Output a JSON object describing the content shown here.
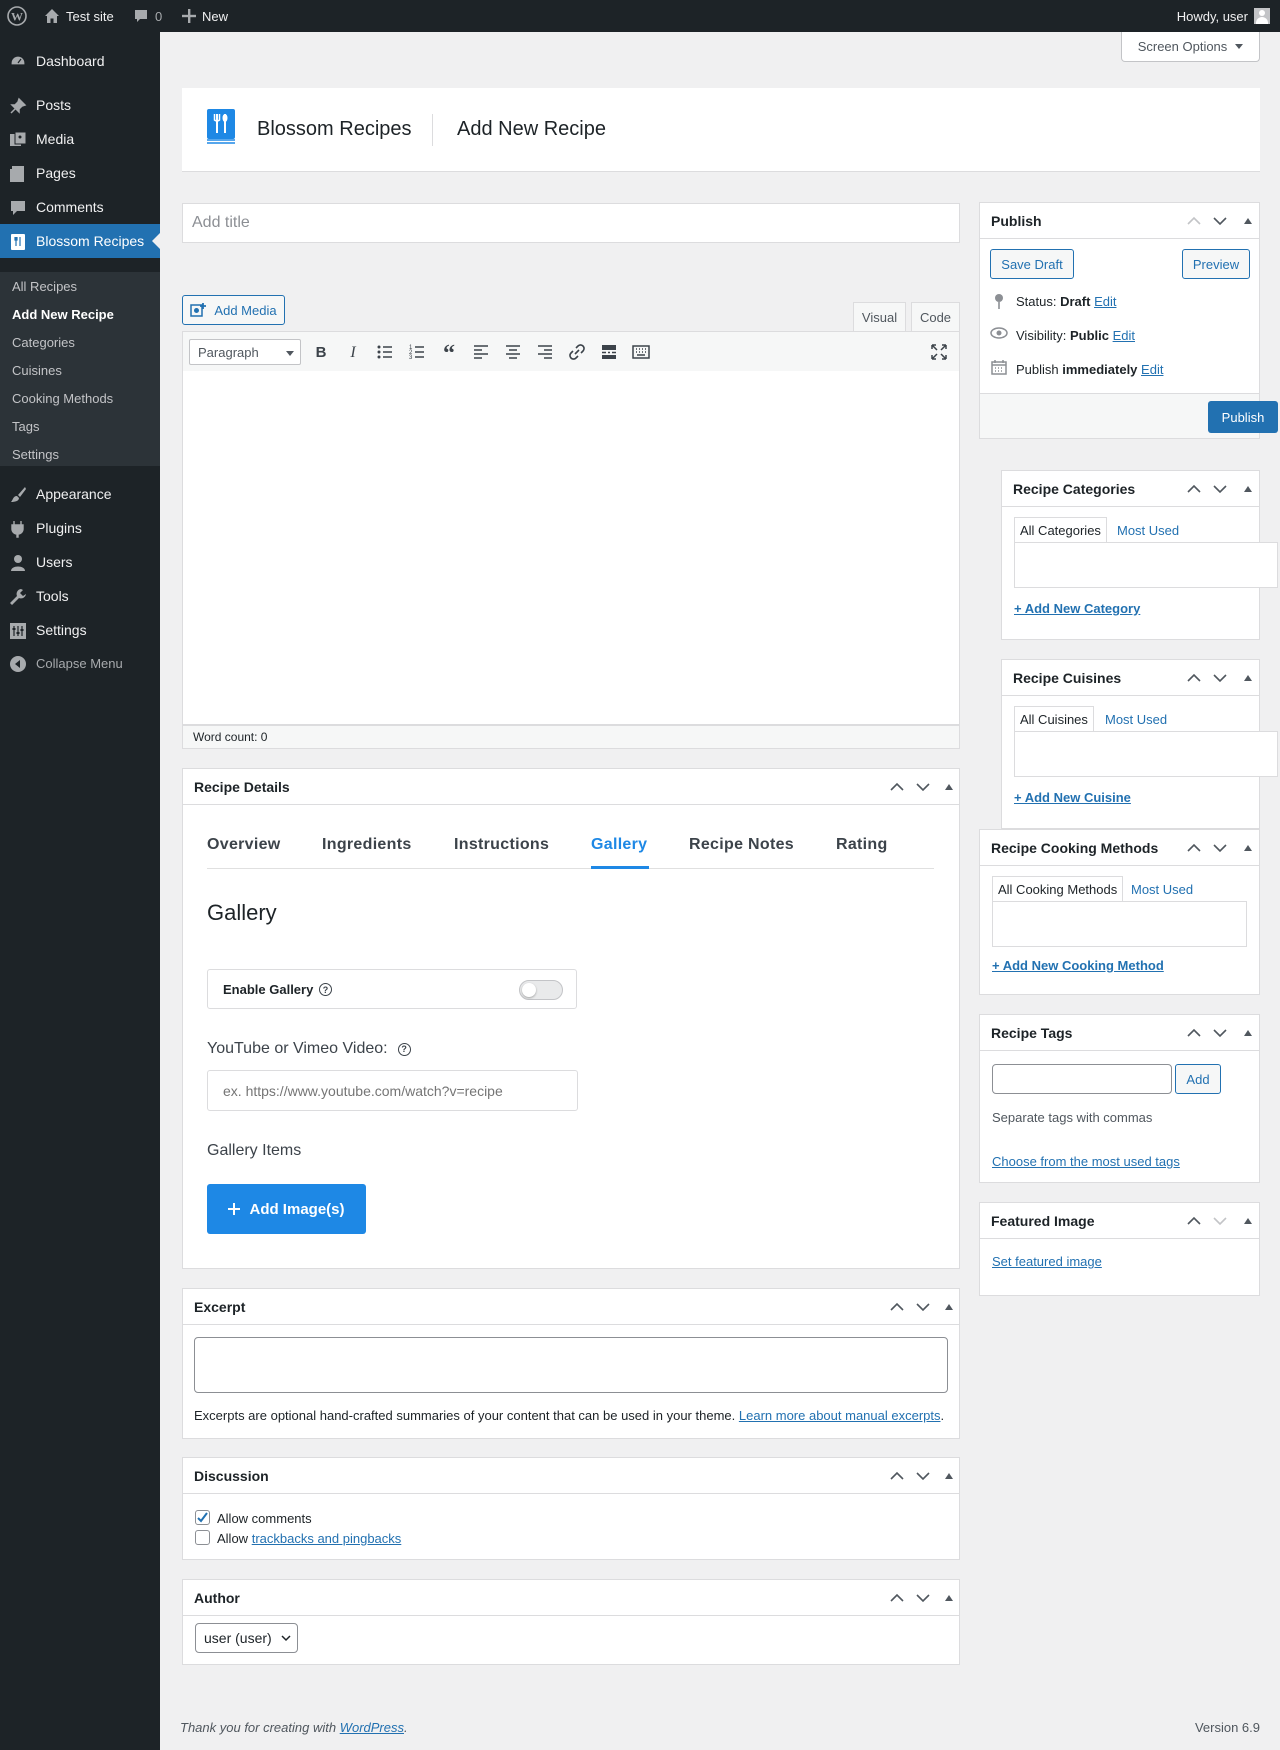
{
  "adminbar": {
    "site_name": "Test site",
    "comments_count": "0",
    "new_label": "New",
    "howdy": "Howdy, user"
  },
  "menu": {
    "items": [
      {
        "label": "Dashboard",
        "icon": "dashboard-icon"
      },
      {
        "label": "Posts",
        "icon": "pin-icon"
      },
      {
        "label": "Media",
        "icon": "media-icon"
      },
      {
        "label": "Pages",
        "icon": "pages-icon"
      },
      {
        "label": "Comments",
        "icon": "comment-icon"
      },
      {
        "label": "Blossom Recipes",
        "icon": "recipe-icon",
        "current": true
      },
      {
        "label": "Appearance",
        "icon": "brush-icon"
      },
      {
        "label": "Plugins",
        "icon": "plugin-icon"
      },
      {
        "label": "Users",
        "icon": "users-icon"
      },
      {
        "label": "Tools",
        "icon": "wrench-icon"
      },
      {
        "label": "Settings",
        "icon": "settings-icon"
      }
    ],
    "submenu": [
      "All Recipes",
      "Add New Recipe",
      "Categories",
      "Cuisines",
      "Cooking Methods",
      "Tags",
      "Settings"
    ],
    "collapse": "Collapse Menu"
  },
  "screen_options": "Screen Options",
  "header": {
    "brand": "Blossom Recipes",
    "page_title": "Add New Recipe"
  },
  "title_placeholder": "Add title",
  "editor": {
    "add_media": "Add Media",
    "tab_visual": "Visual",
    "tab_code": "Code",
    "format": "Paragraph",
    "word_count": "Word count: 0"
  },
  "recipe_details": {
    "title": "Recipe Details",
    "tabs": [
      "Overview",
      "Ingredients",
      "Instructions",
      "Gallery",
      "Recipe Notes",
      "Rating"
    ],
    "active_tab": "Gallery",
    "section_title": "Gallery",
    "enable_gallery": "Enable Gallery",
    "enable_gallery_on": false,
    "video_label": "YouTube or Vimeo Video:",
    "video_placeholder": "ex. https://www.youtube.com/watch?v=recipe",
    "gallery_items": "Gallery Items",
    "add_images": "Add Image(s)"
  },
  "excerpt": {
    "title": "Excerpt",
    "help": "Excerpts are optional hand-crafted summaries of your content that can be used in your theme.",
    "link": "Learn more about manual excerpts",
    "suffix": "."
  },
  "discussion": {
    "title": "Discussion",
    "allow_comments": "Allow comments",
    "allow_comments_checked": true,
    "allow_prefix": "Allow",
    "trackbacks_link": "trackbacks and pingbacks",
    "trackbacks_checked": false
  },
  "author": {
    "title": "Author",
    "selected": "user (user)"
  },
  "publish": {
    "title": "Publish",
    "save_draft": "Save Draft",
    "preview": "Preview",
    "status_label": "Status:",
    "status_value": "Draft",
    "visibility_label": "Visibility:",
    "visibility_value": "Public",
    "publish_label": "Publish",
    "publish_value": "immediately",
    "edit": "Edit",
    "publish_button": "Publish"
  },
  "categories": {
    "title": "Recipe Categories",
    "tab_all": "All Categories",
    "tab_most": "Most Used",
    "add": "+ Add New Category"
  },
  "cuisines": {
    "title": "Recipe Cuisines",
    "tab_all": "All Cuisines",
    "tab_most": "Most Used",
    "add": "+ Add New Cuisine"
  },
  "cooking_methods": {
    "title": "Recipe Cooking Methods",
    "tab_all": "All Cooking Methods",
    "tab_most": "Most Used",
    "add": "+ Add New Cooking Method"
  },
  "tags": {
    "title": "Recipe Tags",
    "add_button": "Add",
    "help": "Separate tags with commas",
    "choose": "Choose from the most used tags"
  },
  "featured": {
    "title": "Featured Image",
    "set": "Set featured image"
  },
  "footer": {
    "thanks_prefix": "Thank you for creating with ",
    "wordpress": "WordPress",
    "thanks_suffix": ".",
    "version": "Version 6.9"
  },
  "colors": {
    "admin_dark": "#1d2327",
    "accent": "#2271b1",
    "recipe_blue": "#1e88e5"
  }
}
